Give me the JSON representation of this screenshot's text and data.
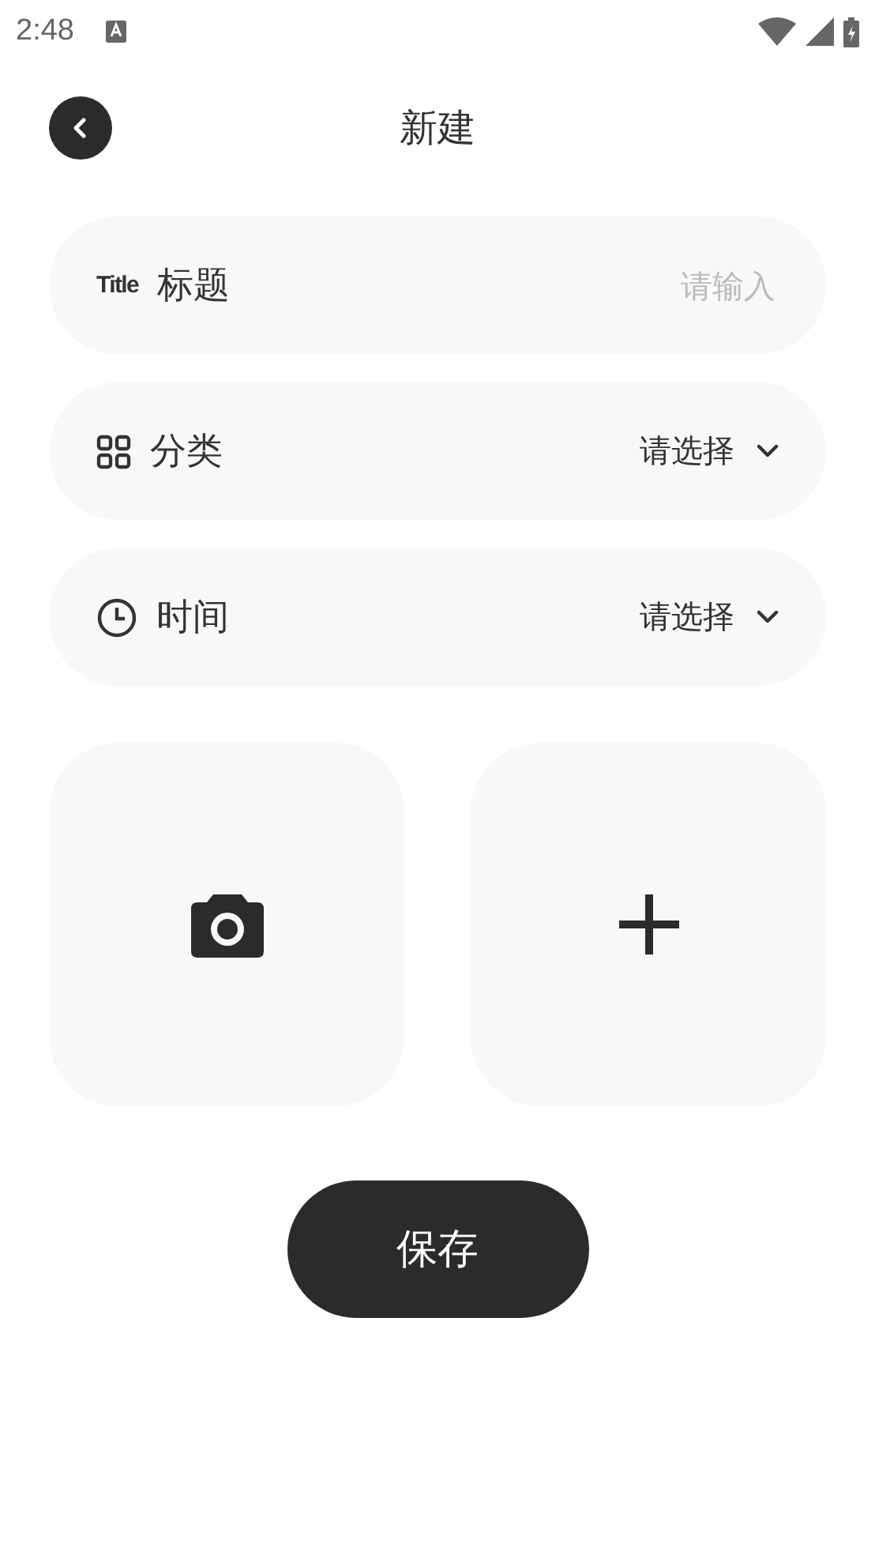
{
  "status_bar": {
    "time": "2:48"
  },
  "header": {
    "title": "新建"
  },
  "fields": [
    {
      "kind": "input",
      "badge": "Title",
      "label": "标题",
      "placeholder": "请输入"
    },
    {
      "kind": "select",
      "label": "分类",
      "value": "请选择"
    },
    {
      "kind": "select",
      "label": "时间",
      "value": "请选择"
    }
  ],
  "save_button": "保存"
}
